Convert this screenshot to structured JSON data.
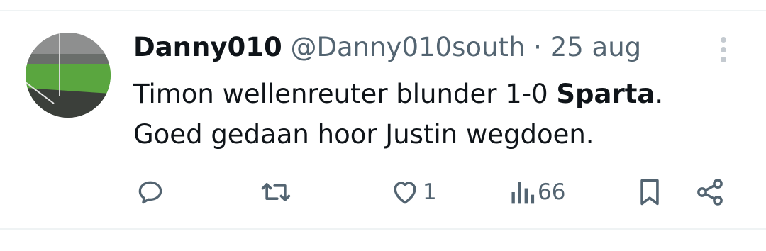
{
  "tweet": {
    "author_name": "Danny010",
    "handle": "@Danny010south",
    "separator": "·",
    "date": "25 aug",
    "text_part1": "Timon wellenreuter blunder 1-0 ",
    "text_bold": "Sparta",
    "text_part2": ".",
    "text_line2": "Goed gedaan hoor Justin wegdoen."
  },
  "actions": {
    "reply_count": "",
    "retweet_count": "",
    "like_count": "1",
    "views_count": "66"
  },
  "icons": {
    "reply": "reply-icon",
    "retweet": "retweet-icon",
    "like": "heart-icon",
    "views": "views-icon",
    "bookmark": "bookmark-icon",
    "share": "share-icon",
    "more": "more-options-icon"
  },
  "colors": {
    "text": "#0f1419",
    "secondary": "#536471",
    "divider": "#eff3f4"
  }
}
